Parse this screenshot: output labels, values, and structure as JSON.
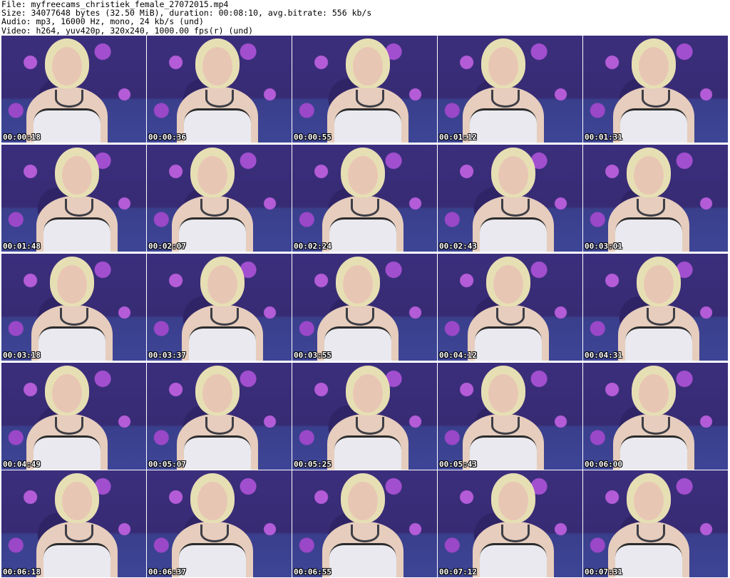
{
  "header": {
    "file": "File: myfreecams_christiek_female_27072015.mp4",
    "size": "Size: 34077648 bytes (32.50 MiB), duration: 00:08:10, avg.bitrate: 556 kb/s",
    "audio": "Audio: mp3, 16000 Hz, mono, 24 kb/s (und)",
    "video": "Video: h264, yuv420p, 320x240, 1000.00 fps(r) (und)"
  },
  "thumbnails": [
    {
      "timestamp": "00:00:18"
    },
    {
      "timestamp": "00:00:36"
    },
    {
      "timestamp": "00:00:55"
    },
    {
      "timestamp": "00:01:12"
    },
    {
      "timestamp": "00:01:31"
    },
    {
      "timestamp": "00:01:48"
    },
    {
      "timestamp": "00:02:07"
    },
    {
      "timestamp": "00:02:24"
    },
    {
      "timestamp": "00:02:43"
    },
    {
      "timestamp": "00:03:01"
    },
    {
      "timestamp": "00:03:18"
    },
    {
      "timestamp": "00:03:37"
    },
    {
      "timestamp": "00:03:55"
    },
    {
      "timestamp": "00:04:12"
    },
    {
      "timestamp": "00:04:31"
    },
    {
      "timestamp": "00:04:49"
    },
    {
      "timestamp": "00:05:07"
    },
    {
      "timestamp": "00:05:25"
    },
    {
      "timestamp": "00:05:43"
    },
    {
      "timestamp": "00:06:00"
    },
    {
      "timestamp": "00:06:18"
    },
    {
      "timestamp": "00:06:37"
    },
    {
      "timestamp": "00:06:55"
    },
    {
      "timestamp": "00:07:12"
    },
    {
      "timestamp": "00:07:31"
    }
  ],
  "colors": {
    "background": "#ffffff",
    "wallpaper": "#3a2d78",
    "flower": "#b45cd8",
    "timestamp_text": "#ffffff"
  }
}
